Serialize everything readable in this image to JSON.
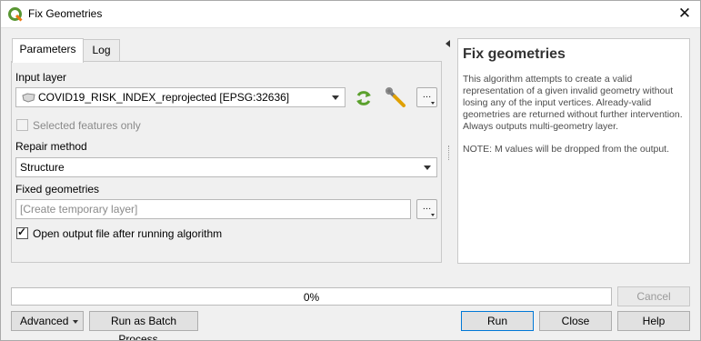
{
  "window": {
    "title": "Fix Geometries",
    "close_glyph": "✕"
  },
  "tabs": [
    {
      "label": "Parameters",
      "active": true
    },
    {
      "label": "Log",
      "active": false
    }
  ],
  "params": {
    "input_layer_label": "Input layer",
    "input_layer_value": "COVID19_RISK_INDEX_reprojected [EPSG:32636]",
    "selected_only_label": "Selected features only",
    "repair_method_label": "Repair method",
    "repair_method_value": "Structure",
    "fixed_geometries_label": "Fixed geometries",
    "fixed_geometries_placeholder": "[Create temporary layer]",
    "open_output_label": "Open output file after running algorithm",
    "open_output_checked": true,
    "ellipsis": "…"
  },
  "help": {
    "title": "Fix geometries",
    "description": "This algorithm attempts to create a valid representation of a given invalid geometry without losing any of the input vertices. Already-valid geometries are returned without further intervention. Always outputs multi-geometry layer.",
    "note": "NOTE: M values will be dropped from the output."
  },
  "progress": {
    "value": 0,
    "text": "0%"
  },
  "buttons": {
    "cancel": "Cancel",
    "advanced": "Advanced",
    "batch": "Run as Batch Process…",
    "run": "Run",
    "close": "Close",
    "help": "Help"
  },
  "colors": {
    "accent": "#0078d7",
    "progress": "#06b025",
    "refresh_icon": "#5aa02c"
  }
}
